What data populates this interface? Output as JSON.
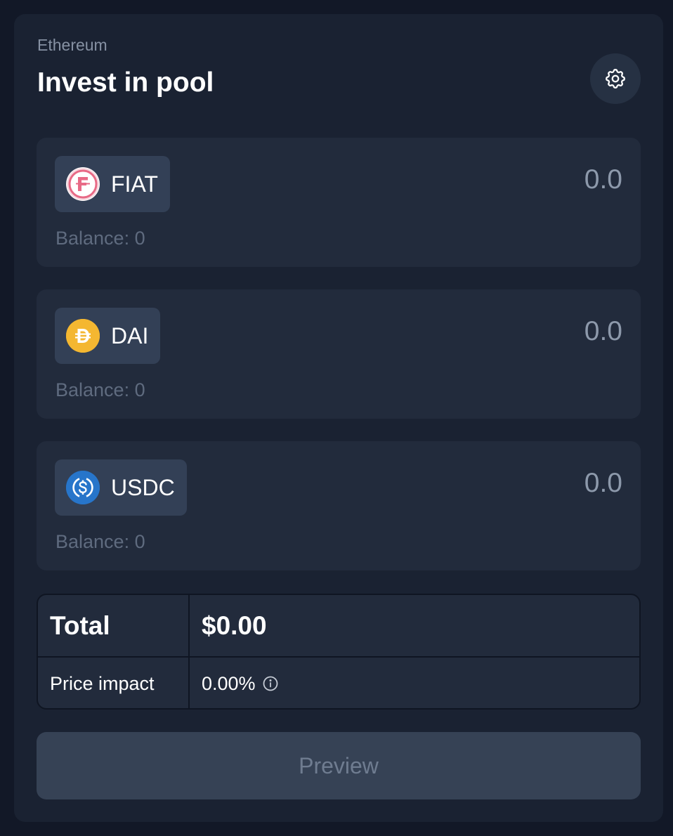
{
  "header": {
    "network": "Ethereum",
    "title": "Invest in pool",
    "settings_icon": "gear-icon"
  },
  "tokens": [
    {
      "symbol": "FIAT",
      "icon": "fiat-token-icon",
      "amount_placeholder": "0.0",
      "balance": "Balance: 0",
      "color": "#e86a86"
    },
    {
      "symbol": "DAI",
      "icon": "dai-token-icon",
      "amount_placeholder": "0.0",
      "balance": "Balance: 0",
      "color": "#f4b731"
    },
    {
      "symbol": "USDC",
      "icon": "usdc-token-icon",
      "amount_placeholder": "0.0",
      "balance": "Balance: 0",
      "color": "#2775ca"
    }
  ],
  "summary": {
    "total_label": "Total",
    "total_value": "$0.00",
    "impact_label": "Price impact",
    "impact_value": "0.00%",
    "info_icon": "info-icon"
  },
  "actions": {
    "preview_label": "Preview"
  },
  "colors": {
    "background": "#121827",
    "card": "#1a2232",
    "row": "#222b3c",
    "token_chip": "#334056",
    "button_disabled": "#364255"
  }
}
